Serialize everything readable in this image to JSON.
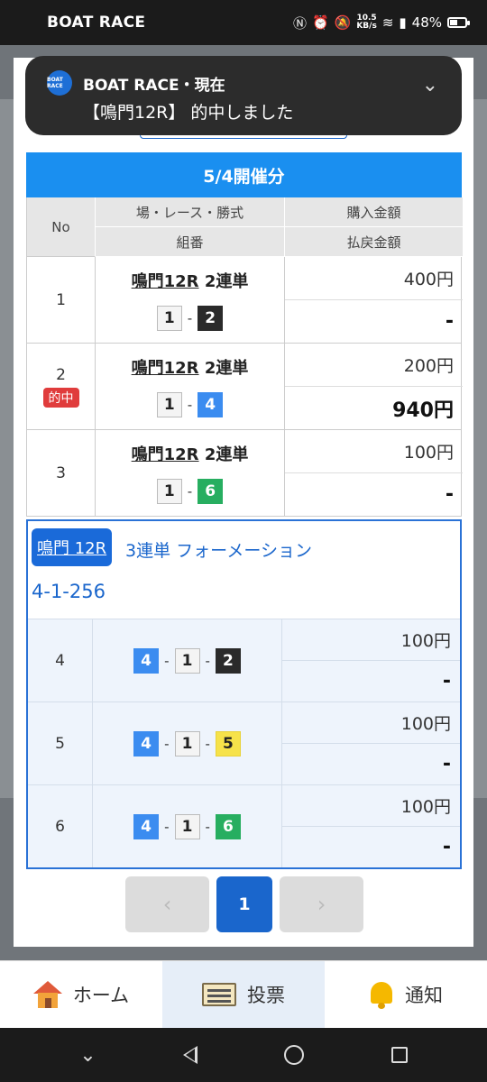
{
  "statusbar": {
    "app_name": "BOAT RACE",
    "net_speed_value": "10.5",
    "net_speed_unit": "KB/s",
    "battery": "48%",
    "battery_level": 0.48
  },
  "notification": {
    "logo_text": "BOAT RACE",
    "title": "BOAT RACE・現在",
    "message": "【鳴門12R】 的中しました"
  },
  "table": {
    "date_header": "5/4開催分",
    "headers": {
      "no": "No",
      "race": "場・レース・勝式",
      "combo": "組番",
      "purchase": "購入金額",
      "payout": "払戻金額"
    },
    "rows": [
      {
        "no": "1",
        "hit": "",
        "venue": "鳴門12R",
        "bet_type": "2連単",
        "combo": [
          "1",
          "2"
        ],
        "purchase": "400円",
        "payout": "-"
      },
      {
        "no": "2",
        "hit": "的中",
        "venue": "鳴門12R",
        "bet_type": "2連単",
        "combo": [
          "1",
          "4"
        ],
        "purchase": "200円",
        "payout": "940円"
      },
      {
        "no": "3",
        "hit": "",
        "venue": "鳴門12R",
        "bet_type": "2連単",
        "combo": [
          "1",
          "6"
        ],
        "purchase": "100円",
        "payout": "-"
      }
    ]
  },
  "formation": {
    "venue": "鳴門 12R",
    "bet_type": "3連単 フォーメーション",
    "pattern": "4-1-256",
    "rows": [
      {
        "no": "4",
        "combo": [
          "4",
          "1",
          "2"
        ],
        "purchase": "100円",
        "payout": "-"
      },
      {
        "no": "5",
        "combo": [
          "4",
          "1",
          "5"
        ],
        "purchase": "100円",
        "payout": "-"
      },
      {
        "no": "6",
        "combo": [
          "4",
          "1",
          "6"
        ],
        "purchase": "100円",
        "payout": "-"
      }
    ]
  },
  "pager": {
    "prev": "‹",
    "current": "1",
    "next": "›"
  },
  "bottom_nav": {
    "home": "ホーム",
    "vote": "投票",
    "notify": "通知"
  },
  "colors": {
    "accent_blue": "#1a8ff0",
    "hit_red": "#e03c3c",
    "boat_2": "#2a2a2a",
    "boat_4": "#3b8cf0",
    "boat_5": "#f6e24a",
    "boat_6": "#27ae60"
  }
}
